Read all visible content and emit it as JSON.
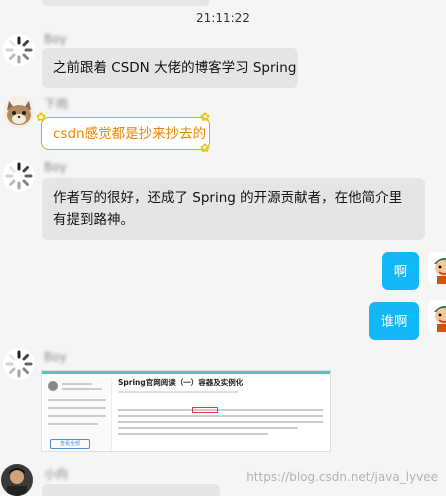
{
  "chat": {
    "timestamp": "21:11:22",
    "messages": [
      {
        "sender": "Boy",
        "avatar": "spinner-avatar",
        "text": "之前跟着 CSDN 大佬的博客学习 Spring"
      },
      {
        "sender": "下雨",
        "avatar": "cat-avatar",
        "text": "csdn感觉都是抄来抄去的"
      },
      {
        "sender": "Boy",
        "avatar": "spinner-avatar",
        "text": "作者写的很好，还成了 Spring 的开源贡献者，在他简介里有提到路神。"
      },
      {
        "sender": "me",
        "avatar": "cartoon-avatar",
        "text": "啊"
      },
      {
        "sender": "me",
        "avatar": "cartoon-avatar",
        "text": "谁啊"
      },
      {
        "sender": "Boy",
        "avatar": "spinner-avatar",
        "image_title": "Spring官网阅读（一）容器及实例化",
        "image_button": "查看全部"
      },
      {
        "sender": "小向",
        "avatar": "person-avatar"
      }
    ]
  },
  "watermark": "https://blog.csdn.net/java_lyvee",
  "colors": {
    "background": "#f5f5f5",
    "bubble_gray": "#e5e5e5",
    "bubble_blue": "#12b7f5",
    "special_border": "#8cc63f",
    "special_text": "#f08300"
  }
}
